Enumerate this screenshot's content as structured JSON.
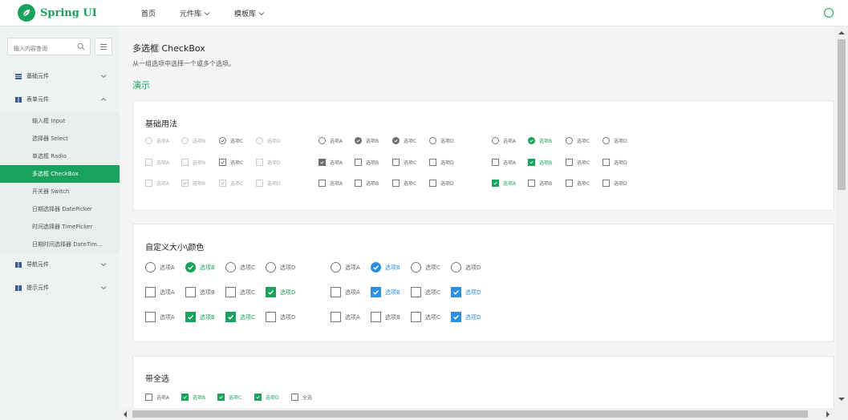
{
  "app": {
    "logo_text": "Spring UI"
  },
  "nav": [
    "首页",
    "元件库",
    "模板库"
  ],
  "sidebar": {
    "search_placeholder": "输入内容查询",
    "groups": [
      {
        "label": "基础元件",
        "expanded": false
      },
      {
        "label": "表单元件",
        "expanded": true
      },
      {
        "label": "导航元件",
        "expanded": false
      },
      {
        "label": "提示元件",
        "expanded": false
      }
    ],
    "sub_items": [
      "输入框 Input",
      "选择器 Select",
      "单选框 Radio",
      "多选框 CheckBox",
      "开关器 Switch",
      "日期选择器 DatePicker",
      "时间选择器 TimePicker",
      "日期时间选择器 DateTim..."
    ],
    "active_sub": "多选框 CheckBox"
  },
  "main": {
    "title": "多选框 CheckBox",
    "description": "从一组选项中选择一个或多个选项。",
    "demo_label": "演示",
    "sections": [
      {
        "title": "基础用法"
      },
      {
        "title": "自定义大小\\颜色"
      },
      {
        "title": "带全选"
      }
    ]
  },
  "options": {
    "a": "选项A",
    "b": "选项B",
    "c": "选项C",
    "d": "选项D",
    "all": "全选"
  },
  "colors": {
    "brand": "#19a25b",
    "blue": "#2d8fe0",
    "sidebar_bg": "#eef2f1"
  }
}
